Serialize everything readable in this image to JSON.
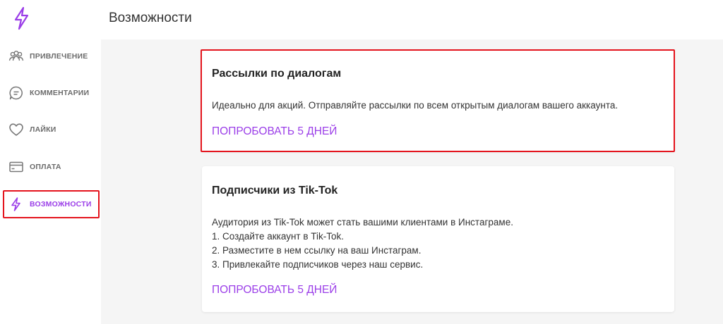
{
  "app": {
    "logo_icon": "lightning-icon",
    "accent_color": "#9b3ee8",
    "highlight_color": "#e4141d"
  },
  "header": {
    "title": "Возможности"
  },
  "sidebar": {
    "items": [
      {
        "label": "Привлечение",
        "icon": "users-icon",
        "active": false
      },
      {
        "label": "Комментарии",
        "icon": "comment-icon",
        "active": false
      },
      {
        "label": "Лайки",
        "icon": "heart-icon",
        "active": false
      },
      {
        "label": "Оплата",
        "icon": "credit-card-icon",
        "active": false
      },
      {
        "label": "Возможности",
        "icon": "lightning-icon",
        "active": true
      }
    ]
  },
  "features": [
    {
      "title": "Рассылки по диалогам",
      "lines": [
        "Идеально для акций. Отправляйте рассылки по всем открытым диалогам вашего аккаунта."
      ],
      "cta": "Попробовать 5 дней"
    },
    {
      "title": "Подписчики из Tik-Tok",
      "lines": [
        "Аудитория из Tik-Tok может стать вашими клиентами в Инстаграме.",
        "1. Создайте аккаунт в Tik-Tok.",
        "2. Разместите в нем ссылку на ваш Инстаграм.",
        "3. Привлекайте подписчиков через наш сервис."
      ],
      "cta": "Попробовать 5 дней"
    }
  ]
}
